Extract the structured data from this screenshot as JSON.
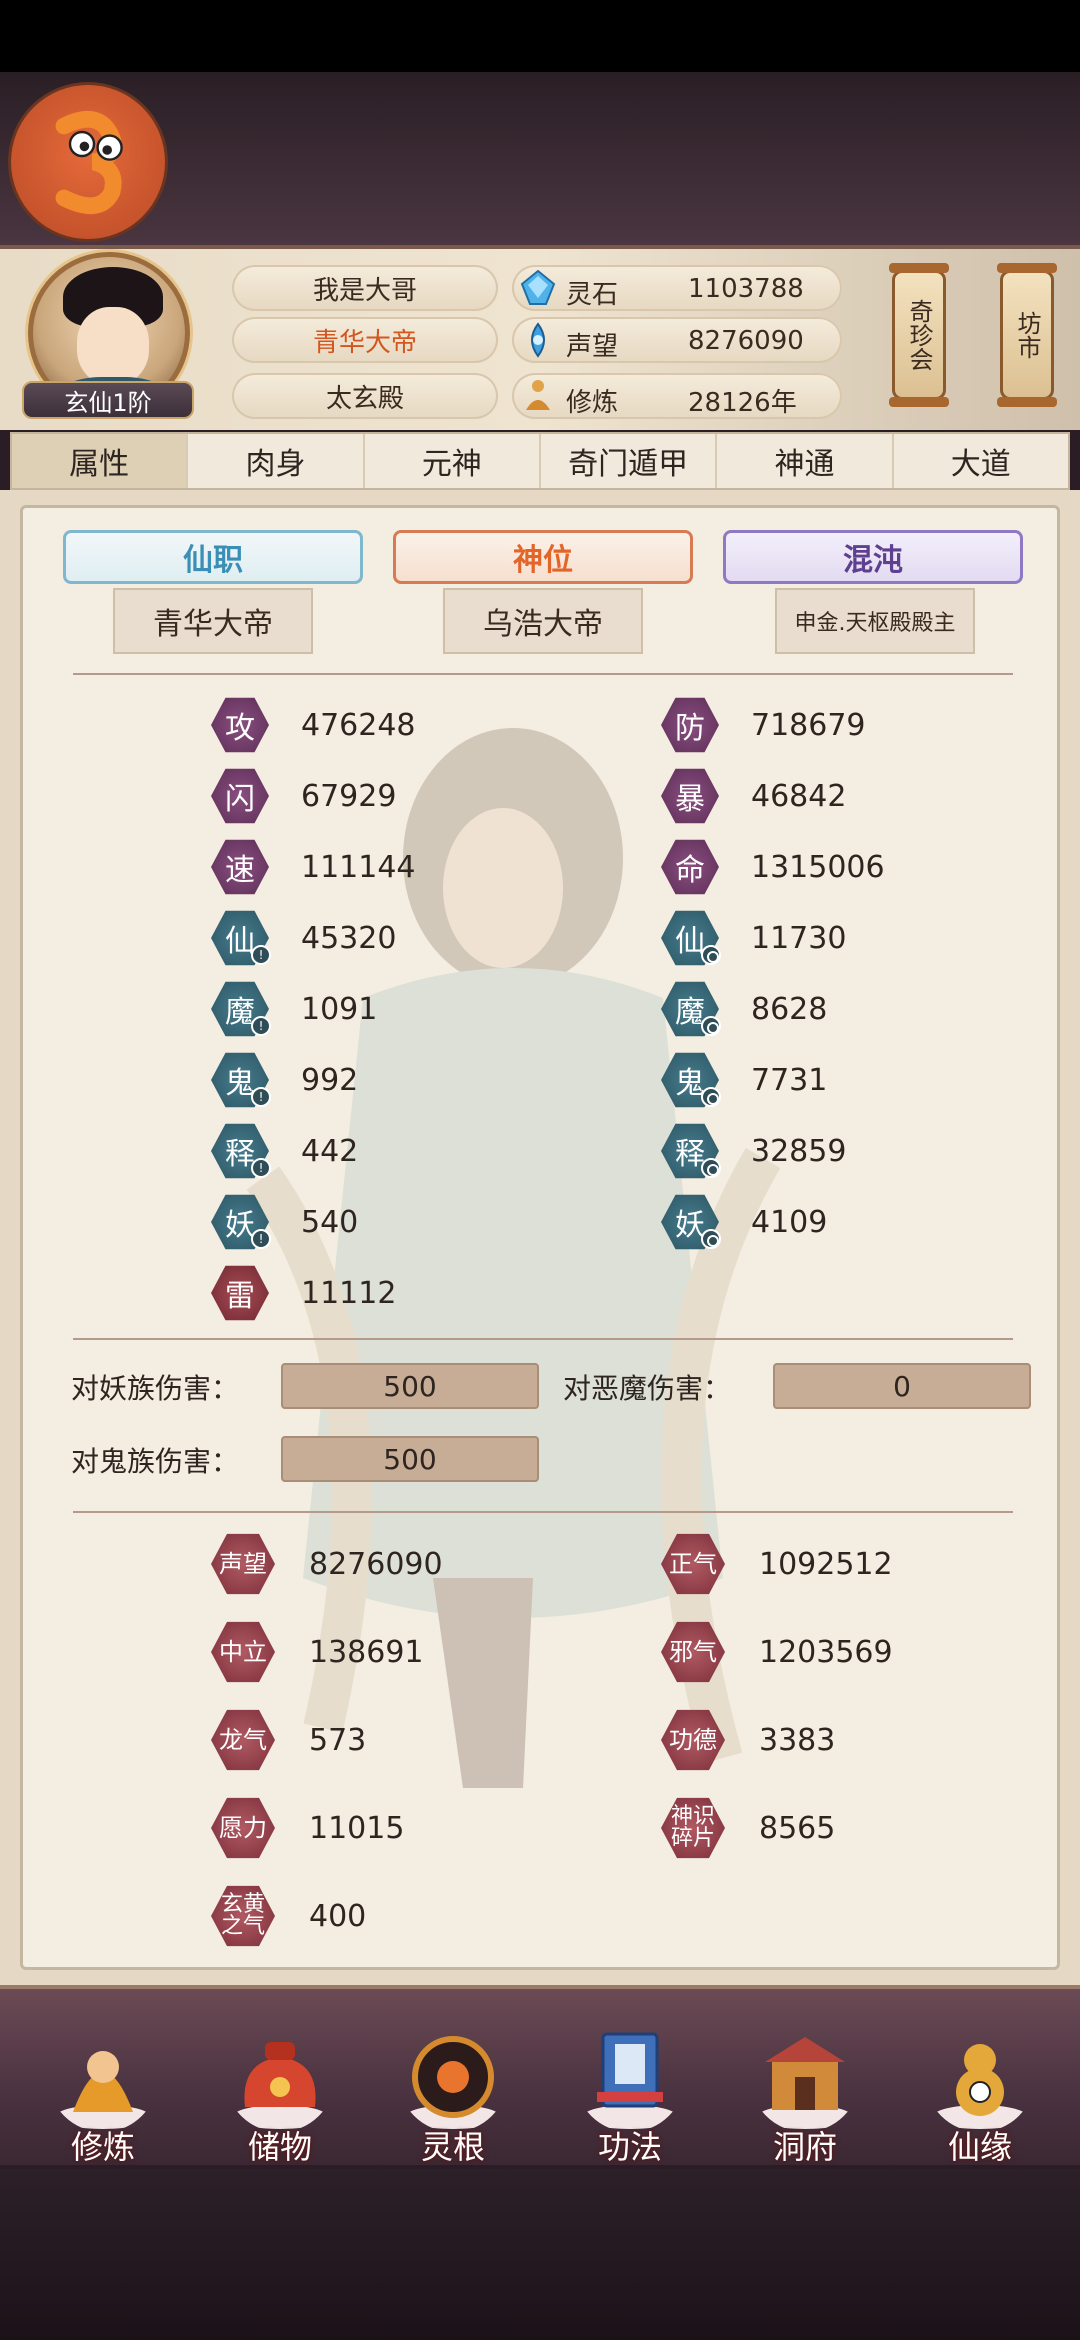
{
  "header": {
    "player_name": "我是大哥",
    "title": "青华大帝",
    "sect": "太玄殿",
    "rank": "玄仙1阶",
    "resources": [
      {
        "label": "灵石",
        "value": "1103788",
        "icon": "spirit-stone-icon"
      },
      {
        "label": "声望",
        "value": "8276090",
        "icon": "prestige-icon"
      },
      {
        "label": "修炼",
        "value": "28126年",
        "icon": "cultivate-icon"
      }
    ],
    "side_buttons": [
      "奇珍会",
      "坊市"
    ]
  },
  "tabs": [
    "属性",
    "肉身",
    "元神",
    "奇门遁甲",
    "神通",
    "大道"
  ],
  "ranks": [
    {
      "title": "仙职",
      "value": "青华大帝"
    },
    {
      "title": "神位",
      "value": "乌浩大帝"
    },
    {
      "title": "混沌",
      "value": "申金.天枢殿殿主"
    }
  ],
  "stats_left": [
    {
      "glyph": "攻",
      "value": "476248"
    },
    {
      "glyph": "闪",
      "value": "67929"
    },
    {
      "glyph": "速",
      "value": "111144"
    },
    {
      "glyph": "仙",
      "value": "45320"
    },
    {
      "glyph": "魔",
      "value": "1091"
    },
    {
      "glyph": "鬼",
      "value": "992"
    },
    {
      "glyph": "释",
      "value": "442"
    },
    {
      "glyph": "妖",
      "value": "540"
    },
    {
      "glyph": "雷",
      "value": "11112"
    }
  ],
  "stats_right": [
    {
      "glyph": "防",
      "value": "718679"
    },
    {
      "glyph": "暴",
      "value": "46842"
    },
    {
      "glyph": "命",
      "value": "1315006"
    },
    {
      "glyph": "仙",
      "value": "11730"
    },
    {
      "glyph": "魔",
      "value": "8628"
    },
    {
      "glyph": "鬼",
      "value": "7731"
    },
    {
      "glyph": "释",
      "value": "32859"
    },
    {
      "glyph": "妖",
      "value": "4109"
    }
  ],
  "damage": [
    {
      "label": "对妖族伤害：",
      "value": "500"
    },
    {
      "label": "对恶魔伤害：",
      "value": "0"
    },
    {
      "label": "对鬼族伤害：",
      "value": "500"
    }
  ],
  "misc_left": [
    {
      "glyph": "声望",
      "value": "8276090"
    },
    {
      "glyph": "中立",
      "value": "138691"
    },
    {
      "glyph": "龙气",
      "value": "573"
    },
    {
      "glyph": "愿力",
      "value": "11015"
    },
    {
      "glyph": "玄黄之气",
      "value": "400"
    }
  ],
  "misc_right": [
    {
      "glyph": "正气",
      "value": "1092512"
    },
    {
      "glyph": "邪气",
      "value": "1203569"
    },
    {
      "glyph": "功德",
      "value": "3383"
    },
    {
      "glyph": "神识碎片",
      "value": "8565"
    }
  ],
  "nav": [
    "修炼",
    "储物",
    "灵根",
    "功法",
    "洞府",
    "仙缘"
  ],
  "colors": {
    "accent_orange": "#e2652a",
    "hex_purple": "#5b2c55",
    "hex_teal": "#2a5462",
    "hex_red": "#7a2d38"
  }
}
